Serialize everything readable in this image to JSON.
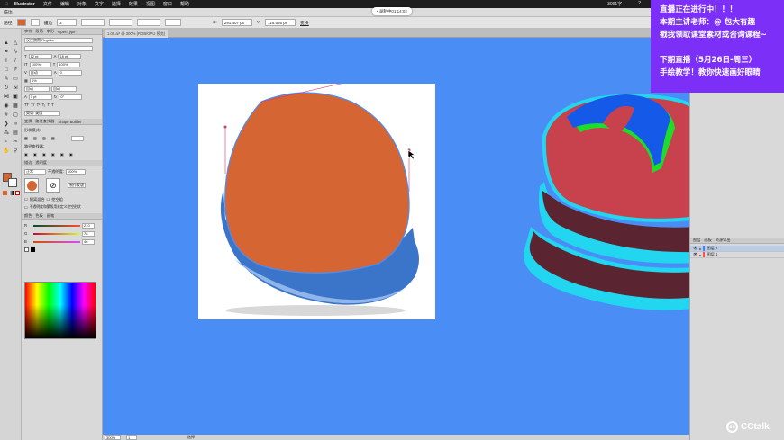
{
  "menubar": {
    "app": "Illustrator",
    "items": [
      "文件",
      "编辑",
      "对象",
      "文字",
      "选择",
      "效果",
      "视图",
      "窗口",
      "帮助"
    ],
    "right_info": "3091字",
    "count": "2"
  },
  "recording": {
    "label": "• 录制中01:14:02"
  },
  "toolbar": {
    "row1_label": "描边",
    "row2": {
      "mode_label": "路径",
      "stroke_label": "描边",
      "stroke_value": "2",
      "x_label": "X:",
      "x_value": "291.407 px",
      "y_label": "Y:",
      "y_value": "115.565 px",
      "transform_label": "变换"
    }
  },
  "document": {
    "tab_title": "1.09.ai* @ 300% (RGB/GPU 预览)"
  },
  "character_panel": {
    "tabs": [
      "字符",
      "段落",
      "字形",
      "OpenType"
    ],
    "font_family": "汉仪旗黑 Regular",
    "font_style": "",
    "font_size": "12 pt",
    "leading": "18 pt",
    "tracking_h": "100%",
    "tracking_v": "100%",
    "kerning": "自动",
    "tracking": "0",
    "baseline_scale": "0%",
    "auto_label": "自动",
    "baseline": "0 pt",
    "rotation": "0°",
    "language": "英语: 美国"
  },
  "path_panel": {
    "tabs": [
      "变换",
      "路径查找器",
      "Shape Builder"
    ],
    "shape_modes_label": "形状模式:",
    "pathfinder_label": "路径查找器:"
  },
  "transparency_panel": {
    "tabs": [
      "描边",
      "透明度"
    ],
    "blend_mode": "正常",
    "opacity_label": "不透明度:",
    "opacity_value": "100%",
    "make_mask": "制作蒙版",
    "option1": "隔离混合",
    "option2": "挖空组",
    "option3": "不透明度和蒙版用来定义挖空形状"
  },
  "color_panel": {
    "tabs": [
      "颜色",
      "色板",
      "画笔"
    ],
    "r_value": "210",
    "g_value": "78",
    "b_value": "46"
  },
  "layers_panel": {
    "tabs": [
      "图层",
      "画板",
      "资源导出"
    ],
    "layers": [
      {
        "name": "图层 2",
        "color": "#4f7cff"
      },
      {
        "name": "图层 1",
        "color": "#ff4f4f"
      }
    ]
  },
  "status": {
    "zoom": "300%",
    "page": "1",
    "mode_label": "选择"
  },
  "live_banner": {
    "line1": "直播正在进行中！！！",
    "line2": "本期主讲老师：@ 包大有趣",
    "line3": "戳我领取课堂素材或咨询课程~",
    "line4": "下期直播（5月26日-周三）",
    "line5": "手绘教学！教你快速画好眼睛"
  },
  "brand": {
    "name": "CCtalk"
  },
  "colors": {
    "canvas": "#4a8ef5",
    "orange_fill": "#d56533",
    "banner": "#7b2ff7",
    "hat_red": "#c8424e",
    "hat_cyan": "#22d6f0",
    "hat_green": "#1ddc2a",
    "hat_dark": "#5a2430"
  },
  "icons": [
    "apple-icon",
    "selection-tool-icon",
    "direct-selection-tool-icon",
    "pen-tool-icon",
    "type-tool-icon",
    "line-tool-icon",
    "rectangle-tool-icon",
    "brush-tool-icon",
    "pencil-tool-icon",
    "eraser-tool-icon",
    "rotate-tool-icon",
    "scale-tool-icon",
    "width-tool-icon",
    "shape-builder-icon",
    "gradient-tool-icon",
    "eyedropper-tool-icon",
    "hand-tool-icon",
    "zoom-tool-icon"
  ]
}
